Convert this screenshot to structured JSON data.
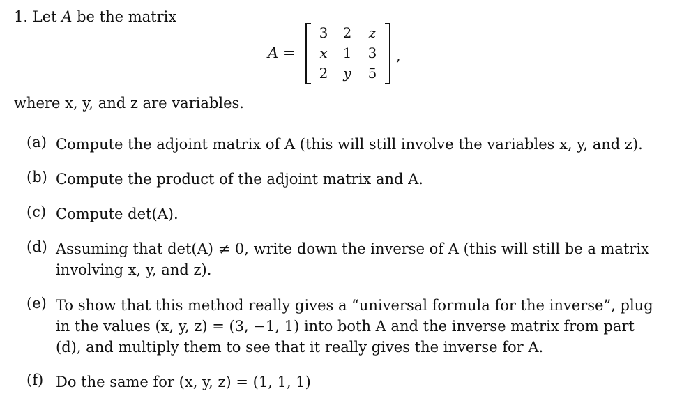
{
  "problem": {
    "number": "1.",
    "intro_pre": "Let ",
    "intro_var": "A",
    "intro_post": " be the matrix",
    "equation_lhs": "A =",
    "matrix": [
      [
        "3",
        "2",
        "z"
      ],
      [
        "x",
        "1",
        "3"
      ],
      [
        "2",
        "y",
        "5"
      ]
    ],
    "trailing_comma": ",",
    "where_text": "where x, y, and z are variables."
  },
  "parts": [
    {
      "label": "(a)",
      "lines": [
        "Compute the adjoint matrix of A (this will still involve the variables x, y, and z)."
      ]
    },
    {
      "label": "(b)",
      "lines": [
        "Compute the product of the adjoint matrix and A."
      ]
    },
    {
      "label": "(c)",
      "lines": [
        "Compute det(A)."
      ]
    },
    {
      "label": "(d)",
      "lines": [
        "Assuming that det(A) ≠ 0, write down the inverse of A (this will still be a matrix",
        "involving x, y, and z)."
      ]
    },
    {
      "label": "(e)",
      "lines": [
        "To show that this method really gives a “universal formula for the inverse”, plug",
        "in the values (x, y, z) = (3, −1, 1) into both A and the inverse matrix from part",
        "(d), and multiply them to see that it really gives the inverse for A."
      ]
    },
    {
      "label": "(f)",
      "lines": [
        "Do the same for (x, y, z) = (1, 1, 1)"
      ]
    }
  ]
}
